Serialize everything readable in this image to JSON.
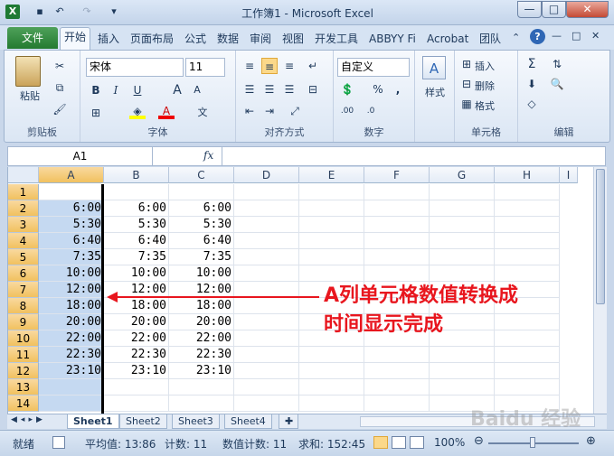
{
  "window": {
    "title": "工作簿1 - Microsoft Excel",
    "min": "—",
    "max": "□",
    "close": "✕"
  },
  "tabs": [
    "开始",
    "插入",
    "页面布局",
    "公式",
    "数据",
    "审阅",
    "视图",
    "开发工具",
    "ABBYY Fi",
    "Acrobat",
    "团队"
  ],
  "file_tab": "文件",
  "ribbon": {
    "clipboard": {
      "label": "剪贴板",
      "paste": "粘贴"
    },
    "font": {
      "label": "字体",
      "name": "宋体",
      "size": "11"
    },
    "alignment": {
      "label": "对齐方式"
    },
    "number": {
      "label": "数字",
      "format": "自定义"
    },
    "styles": {
      "label": "样式"
    },
    "cells": {
      "label": "单元格",
      "insert": "插入",
      "delete": "删除",
      "format": "格式"
    },
    "editing": {
      "label": "编辑"
    }
  },
  "formula_bar": {
    "name_box": "A1",
    "fx": "fx",
    "value": ""
  },
  "columns": [
    "A",
    "B",
    "C",
    "D",
    "E",
    "F",
    "G",
    "H",
    "I"
  ],
  "rows": [
    [
      "",
      "",
      ""
    ],
    [
      "6:00",
      "6:00",
      "6:00"
    ],
    [
      "5:30",
      "5:30",
      "5:30"
    ],
    [
      "6:40",
      "6:40",
      "6:40"
    ],
    [
      "7:35",
      "7:35",
      "7:35"
    ],
    [
      "10:00",
      "10:00",
      "10:00"
    ],
    [
      "12:00",
      "12:00",
      "12:00"
    ],
    [
      "18:00",
      "18:00",
      "18:00"
    ],
    [
      "20:00",
      "20:00",
      "20:00"
    ],
    [
      "22:00",
      "22:00",
      "22:00"
    ],
    [
      "22:30",
      "22:30",
      "22:30"
    ],
    [
      "23:10",
      "23:10",
      "23:10"
    ],
    [
      "",
      "",
      ""
    ],
    [
      "",
      "",
      ""
    ]
  ],
  "row_numbers": [
    "1",
    "2",
    "3",
    "4",
    "5",
    "6",
    "7",
    "8",
    "9",
    "10",
    "11",
    "12",
    "13",
    "14"
  ],
  "annotation": {
    "line1": "A列单元格数值转换成",
    "line2": "时间显示完成",
    "color": "#e8161e"
  },
  "sheets": [
    "Sheet1",
    "Sheet2",
    "Sheet3",
    "Sheet4"
  ],
  "status": {
    "ready": "就绪",
    "average": "平均值: 13:86",
    "count": "计数: 11",
    "numcount": "数值计数: 11",
    "sum": "求和: 152:45",
    "zoom": "100%"
  },
  "watermark": "Baidu 经验"
}
